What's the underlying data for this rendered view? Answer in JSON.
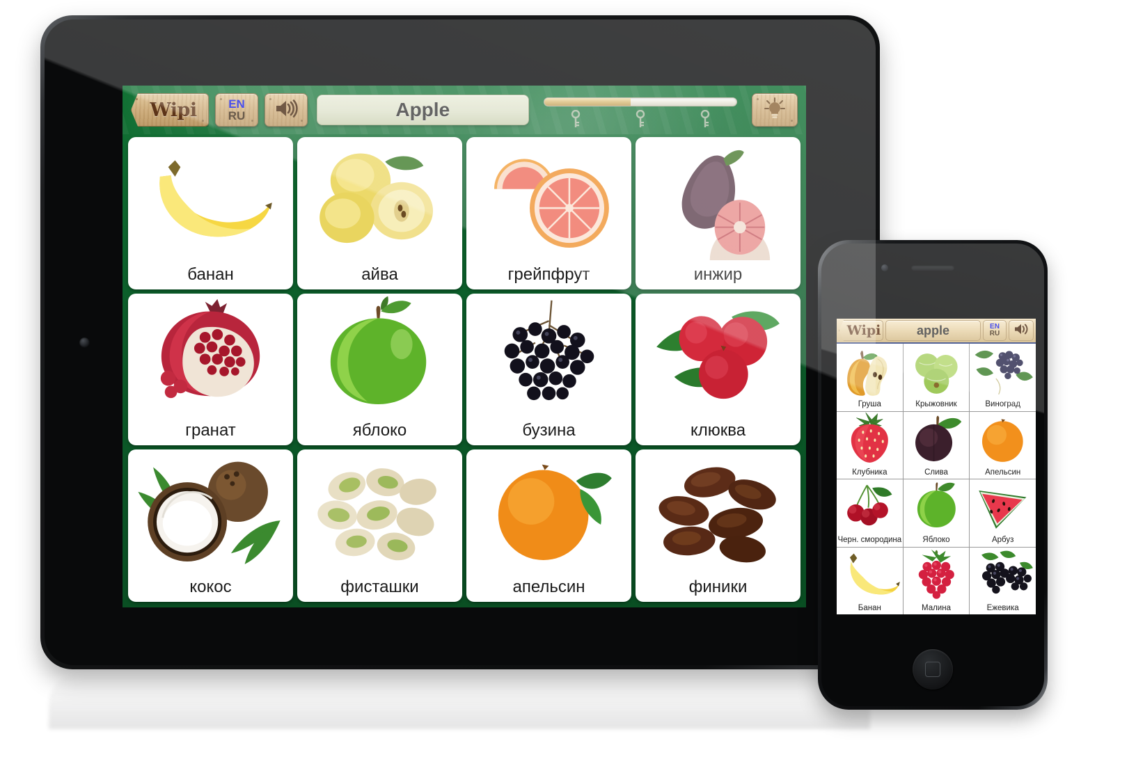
{
  "app": {
    "name": "Wipi",
    "tablet": {
      "toolbar": {
        "home_label": "Wipi",
        "lang_from": "EN",
        "lang_to": "RU",
        "sound_icon": "speaker-icon",
        "title": "Apple",
        "hint_icon": "lightbulb-icon",
        "progress_percent": 45,
        "key_icons": [
          "key-icon",
          "key-icon",
          "key-icon"
        ]
      },
      "cards": [
        {
          "label": "банан",
          "image": "banana"
        },
        {
          "label": "айва",
          "image": "quince"
        },
        {
          "label": "грейпфрут",
          "image": "grapefruit"
        },
        {
          "label": "инжир",
          "image": "fig"
        },
        {
          "label": "гранат",
          "image": "pomegranate"
        },
        {
          "label": "яблоко",
          "image": "green-apple"
        },
        {
          "label": "бузина",
          "image": "elderberry"
        },
        {
          "label": "клюква",
          "image": "cranberry"
        },
        {
          "label": "кокос",
          "image": "coconut"
        },
        {
          "label": "фисташки",
          "image": "pistachios"
        },
        {
          "label": "апельсин",
          "image": "orange"
        },
        {
          "label": "финики",
          "image": "dates"
        }
      ]
    },
    "phone": {
      "toolbar": {
        "home_label": "Wipi",
        "title": "apple",
        "lang_from": "EN",
        "lang_to": "RU",
        "sound_icon": "speaker-icon"
      },
      "cards": [
        {
          "label": "Груша",
          "image": "pear"
        },
        {
          "label": "Крыжовник",
          "image": "gooseberry"
        },
        {
          "label": "Виноград",
          "image": "grapes"
        },
        {
          "label": "Клубника",
          "image": "strawberry"
        },
        {
          "label": "Слива",
          "image": "plum"
        },
        {
          "label": "Апельсин",
          "image": "orange"
        },
        {
          "label": "Черн. смородина",
          "image": "cherry"
        },
        {
          "label": "Яблоко",
          "image": "green-apple"
        },
        {
          "label": "Арбуз",
          "image": "watermelon"
        },
        {
          "label": "Банан",
          "image": "banana"
        },
        {
          "label": "Малина",
          "image": "raspberry"
        },
        {
          "label": "Ежевика",
          "image": "blackberry"
        }
      ]
    }
  },
  "colors": {
    "app_green": "#0c5d2a",
    "wood": "#cfae7c",
    "title_bar": "#dfe3cd",
    "progress_fill": "#d9bc7a",
    "lang_accent": "#1c24e8",
    "card_bg": "#ffffff"
  }
}
